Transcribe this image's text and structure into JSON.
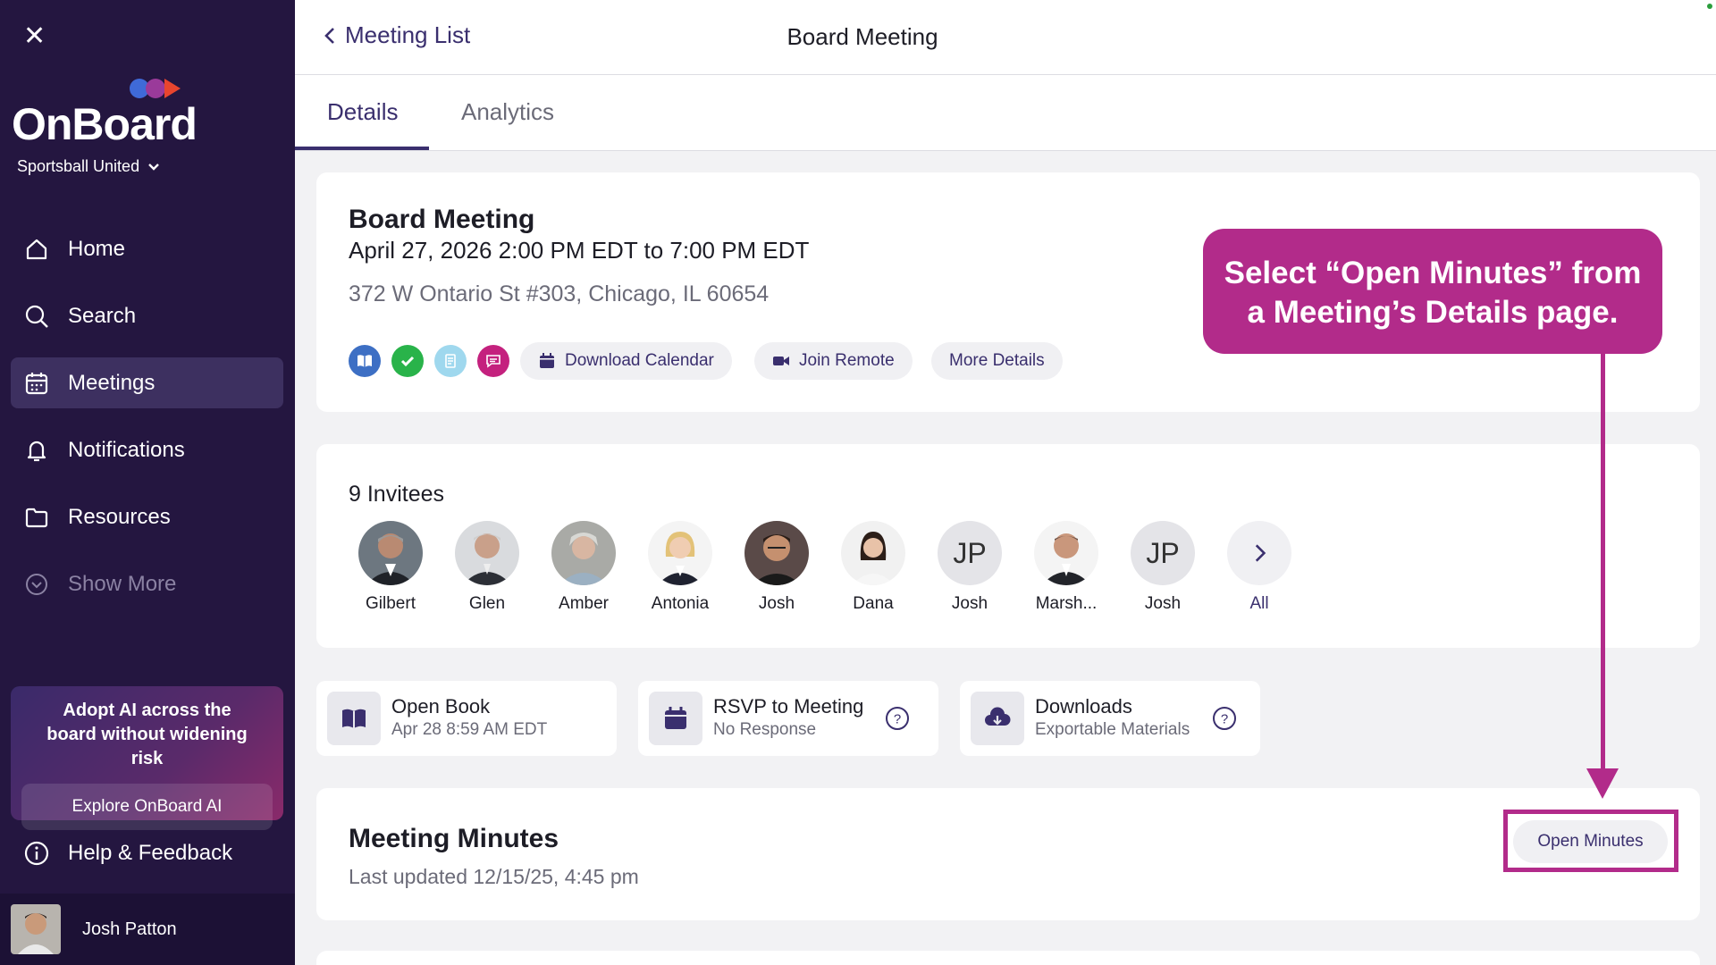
{
  "sidebar": {
    "logo_text": "OnBoard",
    "org_name": "Sportsball United",
    "nav": [
      {
        "label": "Home",
        "icon": "home-icon"
      },
      {
        "label": "Search",
        "icon": "search-icon"
      },
      {
        "label": "Meetings",
        "icon": "calendar-icon",
        "active": true
      },
      {
        "label": "Notifications",
        "icon": "bell-icon"
      },
      {
        "label": "Resources",
        "icon": "folder-icon"
      },
      {
        "label": "Show More",
        "icon": "chevron-down-circle-icon"
      }
    ],
    "promo_text": "Adopt AI across the board without widening risk",
    "promo_button": "Explore OnBoard AI",
    "help_label": "Help & Feedback",
    "user_name": "Josh Patton"
  },
  "header": {
    "back_label": "Meeting List",
    "title": "Board Meeting"
  },
  "tabs": [
    {
      "label": "Details",
      "active": true
    },
    {
      "label": "Analytics",
      "active": false
    }
  ],
  "meeting": {
    "title": "Board Meeting",
    "datetime": "April 27, 2026 2:00 PM EDT to 7:00 PM EDT",
    "address": "372 W Ontario St #303, Chicago, IL 60654",
    "actions": [
      "Download Calendar",
      "Join Remote",
      "More Details"
    ]
  },
  "callout": {
    "line1": "Select “Open Minutes” from",
    "line2": "a Meeting’s Details page."
  },
  "invitees": {
    "title": "9 Invitees",
    "people": [
      {
        "name": "Gilbert",
        "type": "photo"
      },
      {
        "name": "Glen",
        "type": "photo"
      },
      {
        "name": "Amber",
        "type": "photo"
      },
      {
        "name": "Antonia",
        "type": "photo"
      },
      {
        "name": "Josh",
        "type": "photo"
      },
      {
        "name": "Dana",
        "type": "photo"
      },
      {
        "name": "Josh",
        "type": "initials",
        "initials": "JP"
      },
      {
        "name": "Marsh...",
        "type": "photo"
      },
      {
        "name": "Josh",
        "type": "initials",
        "initials": "JP"
      }
    ],
    "all_label": "All"
  },
  "quick_cards": [
    {
      "title": "Open Book",
      "subtitle": "Apr 28 8:59 AM EDT"
    },
    {
      "title": "RSVP to Meeting",
      "subtitle": "No Response"
    },
    {
      "title": "Downloads",
      "subtitle": "Exportable Materials"
    }
  ],
  "minutes": {
    "title": "Meeting Minutes",
    "updated": "Last updated 12/15/25, 4:45 pm",
    "button": "Open Minutes"
  },
  "colors": {
    "sidebar_bg": "#241640",
    "accent": "#3a2f6e",
    "callout": "#b22b8a"
  }
}
